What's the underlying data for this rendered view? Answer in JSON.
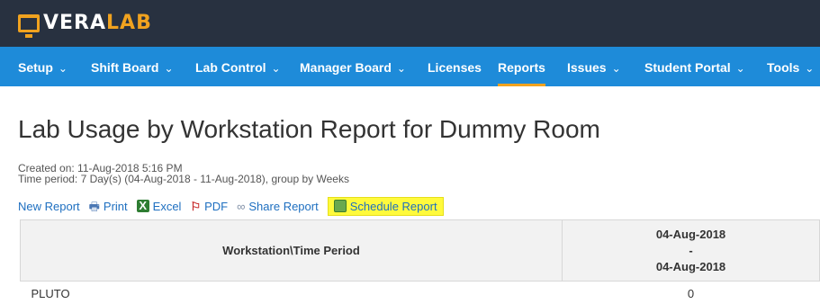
{
  "brand": {
    "vera": "VERA",
    "lab": "LAB",
    "accent": "#f0a21f"
  },
  "nav": {
    "items": [
      {
        "label": "Setup",
        "dropdown": "⌄"
      },
      {
        "label": "Shift Board",
        "dropdown": "⌄"
      },
      {
        "label": "Lab Control",
        "dropdown": "⌄"
      },
      {
        "label": "Manager Board",
        "dropdown": "⌄"
      },
      {
        "label": "Licenses"
      },
      {
        "label": "Reports",
        "active": true
      },
      {
        "label": "Issues",
        "dropdown": "⌄"
      },
      {
        "label": "Student Portal",
        "dropdown": "⌄"
      },
      {
        "label": "Tools",
        "dropdown": "⌄"
      }
    ]
  },
  "report": {
    "title": "Lab Usage by Workstation Report for Dummy Room",
    "created": "Created on: 11-Aug-2018 5:16 PM",
    "period": "Time period: 7 Day(s) (04-Aug-2018 - 11-Aug-2018), group by Weeks"
  },
  "actions": {
    "new_report": "New Report",
    "print": "Print",
    "excel": "Excel",
    "pdf": "PDF",
    "share": "Share Report",
    "schedule": "Schedule Report"
  },
  "table": {
    "col_workstation": "Workstation\\Time Period",
    "period_start": "04-Aug-2018",
    "period_sep": "-",
    "period_end": "04-Aug-2018",
    "rows": [
      {
        "workstation": "PLUTO",
        "value": "0"
      }
    ]
  }
}
